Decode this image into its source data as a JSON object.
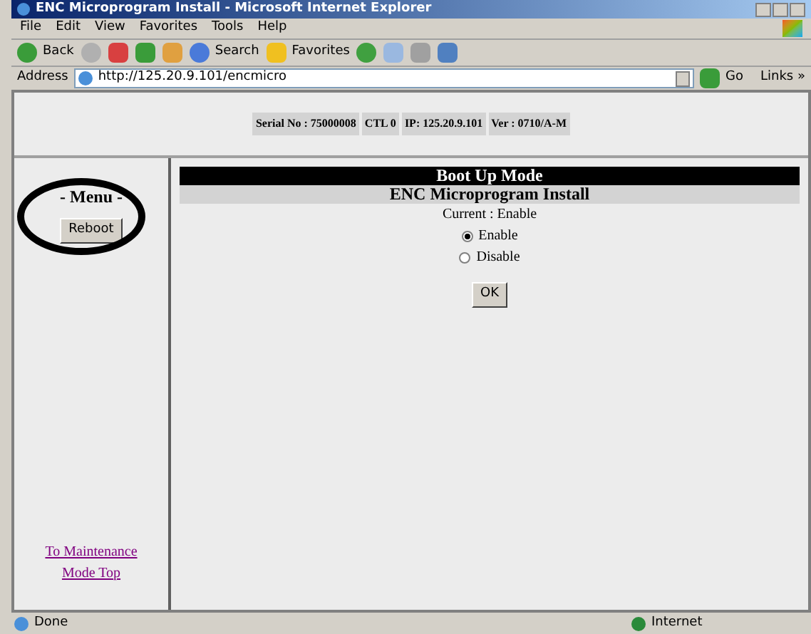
{
  "window": {
    "title": "ENC Microprogram Install - Microsoft Internet Explorer"
  },
  "menu_bar": [
    "File",
    "Edit",
    "View",
    "Favorites",
    "Tools",
    "Help"
  ],
  "toolbar": {
    "back": "Back",
    "search": "Search",
    "favorites": "Favorites"
  },
  "address_bar": {
    "label": "Address",
    "url": "http://125.20.9.101/encmicro",
    "go": "Go",
    "links": "Links »"
  },
  "header": [
    "Serial No : 75000008",
    "CTL 0",
    "IP: 125.20.9.101",
    "Ver : 0710/A-M"
  ],
  "sidebar": {
    "title": "- Menu -",
    "button": "Reboot",
    "link": "To Maintenance Mode Top"
  },
  "content": {
    "heading": "Boot Up Mode",
    "subheading": "ENC Microprogram Install",
    "current": "Current : Enable",
    "options": [
      {
        "label": "Enable",
        "selected": true
      },
      {
        "label": "Disable",
        "selected": false
      }
    ],
    "button": "OK"
  },
  "status_bar": {
    "text": "Done",
    "zone": "Internet"
  }
}
